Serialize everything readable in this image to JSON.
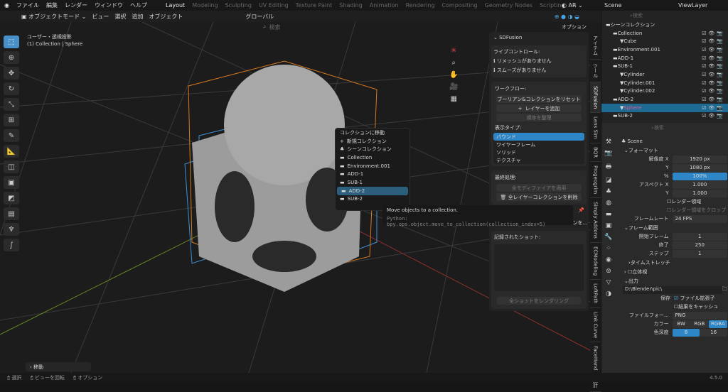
{
  "topbar": {
    "menus": [
      "ファイル",
      "編集",
      "レンダー",
      "ウィンドウ",
      "ヘルプ"
    ],
    "workspaces": [
      "Layout",
      "Modeling",
      "Sculpting",
      "UV Editing",
      "Texture Paint",
      "Shading",
      "Animation",
      "Rendering",
      "Compositing",
      "Geometry Nodes",
      "Scripting",
      "+"
    ],
    "active_workspace": "Layout",
    "render_engine": "AR",
    "scene": "Scene",
    "view_layer": "ViewLayer"
  },
  "viewport_header": {
    "mode": "オブジェクトモード",
    "menus": [
      "ビュー",
      "選択",
      "追加",
      "オブジェクト"
    ],
    "orientation": "グローバル",
    "search_placeholder": "検索",
    "options": "オプション"
  },
  "viewport": {
    "view_name": "ユーザー・透視投影",
    "object_info": "(1) Collection | Sphere",
    "last_op": "移動"
  },
  "npanel": {
    "title": "SDFusion",
    "live_control": "ライブコントロール:",
    "info1": "リメッシュがありません",
    "info2": "スムーズがありません",
    "workflow": "ワークフロー:",
    "reset": "ブーリアン&コレクションをリセット",
    "add_layer": "レイヤーを追加",
    "sort": "順序を整理",
    "display_type": "表示タイプ:",
    "display_options": [
      "バウンド",
      "ワイヤーフレーム",
      "ソリッド",
      "テクスチャ"
    ],
    "display_selected": "バウンド",
    "final": "最終処理:",
    "apply_mods": "全モディファイアを適用",
    "delete_layers": "全レイヤーコレクションを削除",
    "scene_text": "このシーンを...",
    "recorded": "記録されたショット:",
    "render_all": "全ショットをレンダリング"
  },
  "tabs": [
    "アイテム",
    "ツール",
    "SDFusion",
    "Lens Sim",
    "BQR",
    "Progeogrim",
    "Simply Addons",
    "ECModeling",
    "LoftPath",
    "Link Curve",
    "FaceHand",
    "統計"
  ],
  "menu": {
    "title": "コレクションに移動",
    "new": "新規コレクション",
    "items": [
      "シーンコレクション",
      "Collection",
      "Environment.001",
      "ADD-1",
      "SUB-1",
      "ADD-2",
      "SUB-2"
    ],
    "highlighted": "ADD-2"
  },
  "tooltip": {
    "text": "Move objects to a collection.",
    "python": "Python: bpy.ops.object.move_to_collection(collection_index=5)"
  },
  "outliner": {
    "search_placeholder": "検索",
    "rows": [
      {
        "name": "シーンコレクション",
        "indent": 0
      },
      {
        "name": "Collection",
        "indent": 1
      },
      {
        "name": "Cube",
        "indent": 2
      },
      {
        "name": "Environment.001",
        "indent": 1
      },
      {
        "name": "ADD-1",
        "indent": 1
      },
      {
        "name": "SUB-1",
        "indent": 1
      },
      {
        "name": "Cylinder",
        "indent": 2
      },
      {
        "name": "Cylinder.001",
        "indent": 2
      },
      {
        "name": "Cylinder.002",
        "indent": 2
      },
      {
        "name": "ADD-2",
        "indent": 1
      },
      {
        "name": "Sphere",
        "indent": 2
      },
      {
        "name": "SUB-2",
        "indent": 1
      }
    ],
    "selected": "Sphere"
  },
  "props": {
    "search_placeholder": "検索",
    "scene": "Scene",
    "format": "フォーマット",
    "res_x_label": "解像度 X",
    "res_x": "1920 px",
    "y_label": "Y",
    "res_y": "1080 px",
    "pct_label": "%",
    "pct": "100%",
    "aspect_label": "アスペクト X",
    "aspect_x": "1.000",
    "aspect_y": "1.000",
    "render_region": "レンダー領域",
    "crop": "レンダー領域をクロップ",
    "fps_label": "フレームレート",
    "fps": "24 FPS",
    "frame_range": "フレーム範囲",
    "start_label": "開始フレーム",
    "start": "1",
    "end_label": "終了",
    "end": "250",
    "step_label": "ステップ",
    "step": "1",
    "time_stretch": "タイムストレッチ",
    "stereo": "立体視",
    "output": "出力",
    "path": "D:\\Blender\\pic\\",
    "save_label": "保存",
    "file_ext": "ファイル拡張子",
    "cache": "結果をキャッシュ",
    "file_format_label": "ファイルフォー...",
    "file_format": "PNG",
    "color_label": "カラー",
    "colors": [
      "BW",
      "RGB",
      "RGBA"
    ],
    "depth_label": "色深度",
    "depths": [
      "8",
      "16"
    ]
  },
  "status": {
    "select": "選択",
    "rotate": "ビューを回転",
    "options": "オプション",
    "version": "4.5.0"
  }
}
